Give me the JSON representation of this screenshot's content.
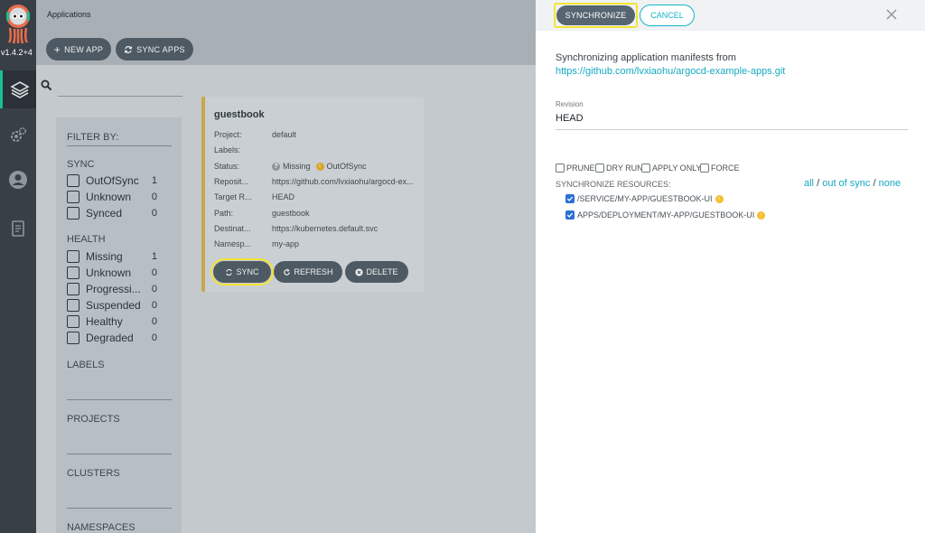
{
  "nav": {
    "version": "v1.4.2+4",
    "items": [
      "applications-icon",
      "settings-icon",
      "user-icon",
      "docs-icon"
    ]
  },
  "main": {
    "title": "Applications",
    "new_app_label": "NEW APP",
    "sync_apps_label": "SYNC APPS"
  },
  "filters": {
    "heading": "FILTER BY:",
    "sync": {
      "title": "SYNC",
      "items": [
        {
          "label": "OutOfSync",
          "count": "1"
        },
        {
          "label": "Unknown",
          "count": "0"
        },
        {
          "label": "Synced",
          "count": "0"
        }
      ]
    },
    "health": {
      "title": "HEALTH",
      "items": [
        {
          "label": "Missing",
          "count": "1"
        },
        {
          "label": "Unknown",
          "count": "0"
        },
        {
          "label": "Progressi...",
          "count": "0"
        },
        {
          "label": "Suspended",
          "count": "0"
        },
        {
          "label": "Healthy",
          "count": "0"
        },
        {
          "label": "Degraded",
          "count": "0"
        }
      ]
    },
    "labels_title": "LABELS",
    "projects_title": "PROJECTS",
    "clusters_title": "CLUSTERS",
    "namespaces_title": "NAMESPACES"
  },
  "app_card": {
    "name": "guestbook",
    "rows": [
      {
        "key": "Project:",
        "value": "default"
      },
      {
        "key": "Labels:",
        "value": ""
      },
      {
        "key": "Status:",
        "value": "Missing",
        "value2": "OutOfSync"
      },
      {
        "key": "Reposit...",
        "value": "https://github.com/lvxiaohu/argocd-ex..."
      },
      {
        "key": "Target R...",
        "value": "HEAD"
      },
      {
        "key": "Path:",
        "value": "guestbook"
      },
      {
        "key": "Destinat...",
        "value": "https://kubernetes.default.svc"
      },
      {
        "key": "Namesp...",
        "value": "my-app"
      }
    ],
    "sync_label": "SYNC",
    "refresh_label": "REFRESH",
    "delete_label": "DELETE"
  },
  "panel": {
    "synchronize_label": "SYNCHRONIZE",
    "cancel_label": "CANCEL",
    "intro_text": "Synchronizing application manifests from",
    "repo_url": "https://github.com/lvxiaohu/argocd-example-apps.git",
    "revision_label": "Revision",
    "revision_value": "HEAD",
    "options": [
      {
        "label": "PRUNE",
        "checked": false
      },
      {
        "label": "DRY RUN",
        "checked": false
      },
      {
        "label": "APPLY ONLY",
        "checked": false
      },
      {
        "label": "FORCE",
        "checked": false
      }
    ],
    "resources_label": "SYNCHRONIZE RESOURCES:",
    "select_all": "all",
    "select_out_of_sync": "out of sync",
    "select_none": "none",
    "separator": "/",
    "resources": [
      {
        "label": "/SERVICE/MY-APP/GUESTBOOK-UI",
        "checked": true
      },
      {
        "label": "APPS/DEPLOYMENT/MY-APP/GUESTBOOK-UI",
        "checked": true
      }
    ]
  },
  "colors": {
    "accent": "#11b6c8",
    "highlight": "#f3e332",
    "card_border": "#c9a84a",
    "warning": "#f4c030"
  }
}
